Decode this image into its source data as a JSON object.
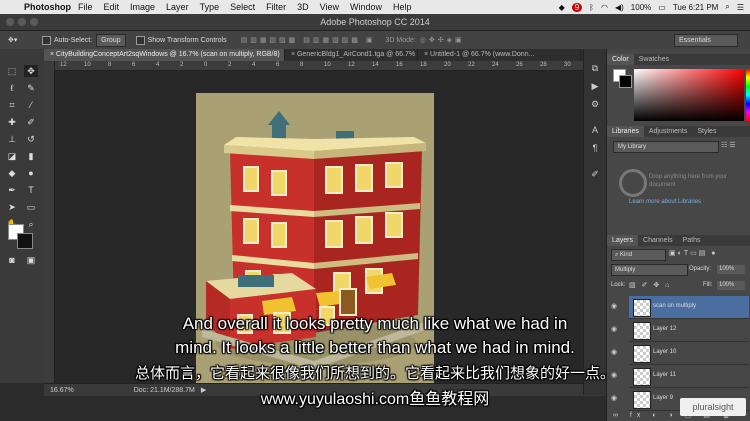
{
  "menubar": {
    "app_name": "Photoshop",
    "items": [
      "File",
      "Edit",
      "Image",
      "Layer",
      "Type",
      "Select",
      "Filter",
      "3D",
      "View",
      "Window",
      "Help"
    ],
    "status_badge": "9",
    "battery": "100%",
    "clock": "Tue 6:21 PM"
  },
  "window": {
    "title": "Adobe Photoshop CC 2014"
  },
  "options_bar": {
    "auto_select_label": "Auto-Select:",
    "auto_select_value": "Group",
    "transform_label": "Show Transform Controls",
    "mode_3d_label": "3D Mode:",
    "workspace": "Essentials"
  },
  "tabs": [
    {
      "label": "CityBuildingConceptArt2sqWindows @ 16.7% (scan on multiply, RGB/8)"
    },
    {
      "label": "GenericBldg1_AirCond1.tga @ 66.7%"
    },
    {
      "label": "Untitled-1 @ 66.7% (www.Donn..."
    }
  ],
  "ruler_labels": [
    "12",
    "10",
    "8",
    "6",
    "4",
    "2",
    "0",
    "2",
    "4",
    "6",
    "8",
    "10",
    "12",
    "14",
    "16",
    "18",
    "20",
    "22",
    "24",
    "26",
    "28",
    "30",
    "32"
  ],
  "status_bar": {
    "zoom": "16.67%",
    "doc": "Doc: 21.1M/288.7M"
  },
  "color_panel": {
    "tab_color": "Color",
    "tab_swatches": "Swatches"
  },
  "libraries_panel": {
    "tab_libraries": "Libraries",
    "tab_adjustments": "Adjustments",
    "tab_styles": "Styles",
    "library_name": "My Library",
    "hint": "Drop anything here from your document",
    "link": "Learn more about Libraries"
  },
  "layers_panel": {
    "tab_layers": "Layers",
    "tab_channels": "Channels",
    "tab_paths": "Paths",
    "kind": "Kind",
    "blend_mode": "Multiply",
    "opacity_label": "Opacity:",
    "opacity": "100%",
    "lock_label": "Lock:",
    "fill_label": "Fill:",
    "fill": "100%",
    "layers": [
      "scan on multiply",
      "Layer 12",
      "Layer 10",
      "Layer 11",
      "Layer 9"
    ]
  },
  "watermark": "pluralsight",
  "subtitles": {
    "line1": "And overall it looks pretty much like what we had in",
    "line2": "mind. It looks a little better than what we had in mind.",
    "line3": "总体而言，它看起来很像我们所想到的。它看起来比我们想象的好一点。",
    "line4": "www.yuyulaoshi.com鱼鱼教程网"
  },
  "colors": {
    "artwork_bg": "#a9a074",
    "brick": "#c8302b",
    "selected_layer": "#4a6ea0",
    "accent_link": "#7aaee0"
  }
}
